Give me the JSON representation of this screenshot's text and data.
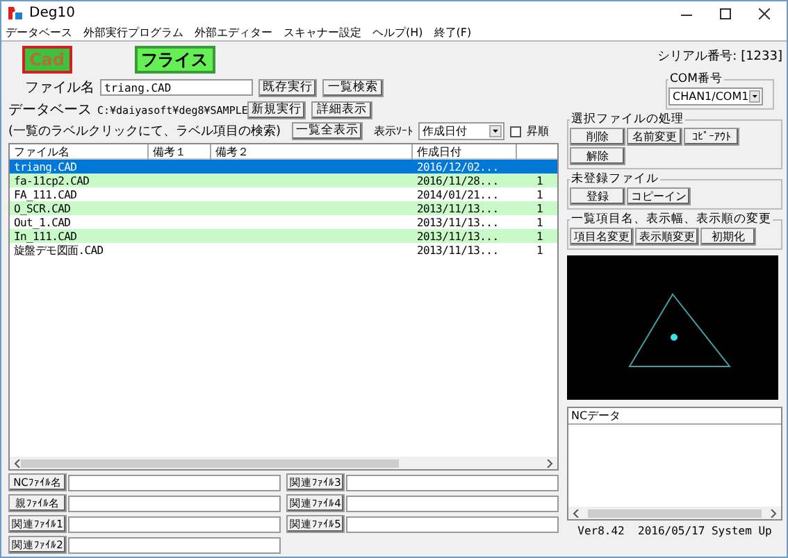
{
  "window": {
    "title": "Deg10"
  },
  "menu": [
    "データベース",
    "外部実行プログラム",
    "外部エディター",
    "スキャナー設定",
    "ヘルプ(H)",
    "終了(F)"
  ],
  "mode_buttons": [
    {
      "label": "Cad",
      "selected": true
    },
    {
      "label": "フライス",
      "selected": false
    }
  ],
  "file_name": {
    "label": "ファイル名",
    "value": "triang.CAD"
  },
  "database": {
    "label": "データベース",
    "path": "C:¥daiyasoft¥deg8¥SAMPLE"
  },
  "hint": "(一覧のラベルクリックにて、ラベル項目の検索)",
  "top_buttons": [
    "既存実行",
    "一覧検索",
    "新規実行",
    "詳細表示",
    "一覧全表示"
  ],
  "sort": {
    "label": "表示ｿｰﾄ",
    "value": "作成日付",
    "ascending_label": "昇順",
    "ascending": false
  },
  "table": {
    "columns": [
      "ファイル名",
      "備考１",
      "備考２",
      "作成日付"
    ],
    "rows": [
      {
        "name": "triang.CAD",
        "date": "2016/12/02...",
        "selected": true
      },
      {
        "name": "fa-11cp2.CAD",
        "date": "2016/11/28...",
        "column_5": "1",
        "selected": false
      },
      {
        "name": "FA_111.CAD",
        "date": "2014/01/21...",
        "column_5": "1",
        "selected": false
      },
      {
        "name": "O_SCR.CAD",
        "date": "2013/11/13...",
        "column_5": "1",
        "selected": false
      },
      {
        "name": "Out_1.CAD",
        "date": "2013/11/13...",
        "column_5": "1",
        "selected": false
      },
      {
        "name": "In_111.CAD",
        "date": "2013/11/13...",
        "column_5": "1",
        "selected": false
      },
      {
        "name": "旋盤デモ図面.CAD",
        "date": "2013/11/13...",
        "column_5": "1",
        "selected": false
      }
    ]
  },
  "related_fields": [
    [
      "NCﾌｧｲﾙ名",
      "親ﾌｧｲﾙ名",
      "関連ﾌｧｲﾙ1",
      "関連ﾌｧｲﾙ2"
    ],
    [
      "関連ﾌｧｲﾙ3",
      "関連ﾌｧｲﾙ4",
      "関連ﾌｧｲﾙ5"
    ]
  ],
  "serial": "シリアル番号: [1233]",
  "com": {
    "title": "COM番号",
    "value": "CHAN1/COM1"
  },
  "groups": [
    {
      "title": "選択ファイルの処理",
      "buttons": [
        "削除",
        "名前変更",
        "ｺﾋﾟｰｱｳﾄ",
        "解除"
      ]
    },
    {
      "title": "未登録ファイル",
      "buttons": [
        "登録",
        "コピーイン"
      ]
    },
    {
      "title": "一覧項目名、表示幅、表示順の変更",
      "buttons": [
        "項目名変更",
        "表示順変更",
        "初期化"
      ]
    }
  ],
  "nc_data": {
    "title": "NCデータ"
  },
  "version": "Ver8.42  2016/05/17 System Up"
}
